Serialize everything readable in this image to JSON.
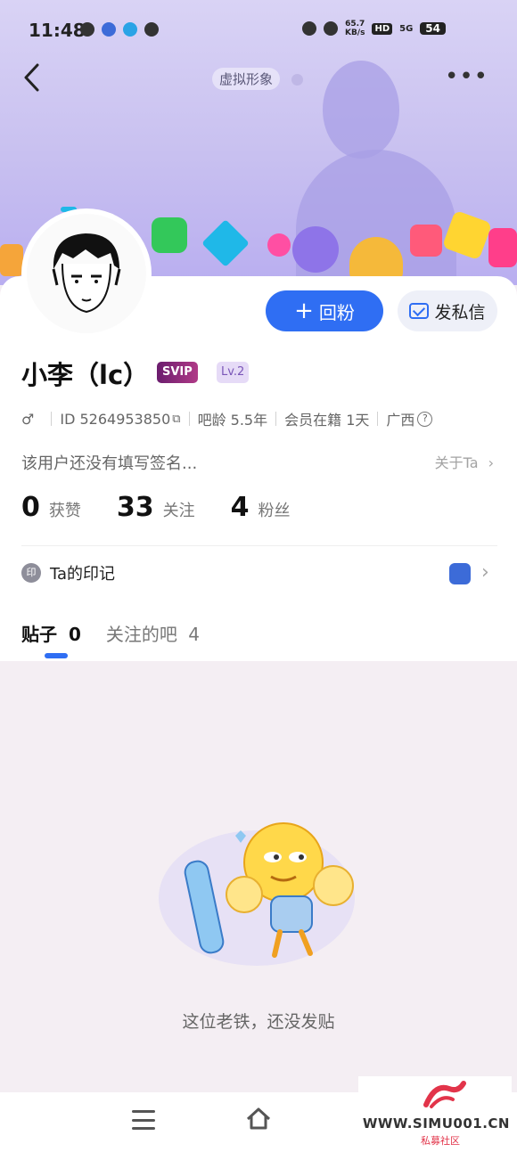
{
  "status_bar": {
    "time": "11:48",
    "net_speed_value": "65.7",
    "net_speed_unit": "KB/s",
    "hd": "HD",
    "signal": "5G",
    "battery": "54"
  },
  "header": {
    "virtual_avatar_label": "虚拟形象",
    "more": "•••"
  },
  "profile": {
    "username": "小李（lc）",
    "svip_label": "SVIP",
    "level_label": "Lv.2",
    "gender": "♂",
    "id_text": "ID 5264953850",
    "bar_age": "吧龄 5.5年",
    "member_days": "会员在籍 1天",
    "location": "广西",
    "signature": "该用户还没有填写签名...",
    "about_link": "关于Ta"
  },
  "actions": {
    "follow_back_label": "回粉",
    "message_label": "发私信"
  },
  "stats": [
    {
      "value": "0",
      "label": "获赞"
    },
    {
      "value": "33",
      "label": "关注"
    },
    {
      "value": "4",
      "label": "粉丝"
    }
  ],
  "mark": {
    "icon_text": "印",
    "label": "Ta的印记"
  },
  "tabs": [
    {
      "label": "贴子",
      "count": "0",
      "active": true
    },
    {
      "label": "关注的吧",
      "count": "4",
      "active": false
    }
  ],
  "empty_state": {
    "message": "这位老铁，还没发贴"
  },
  "watermark": {
    "text": "WWW.SIMU001.CN",
    "subtext": "私募社区"
  },
  "colors": {
    "accent": "#2f6ef3",
    "banner": "#c8c0f0",
    "background": "#f4eef3"
  }
}
